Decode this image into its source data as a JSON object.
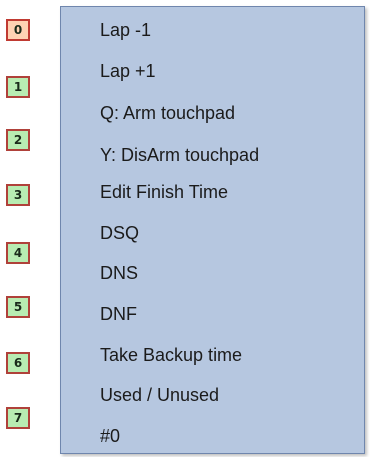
{
  "lane_buttons": [
    {
      "label": "0",
      "selected": true
    },
    {
      "label": "1",
      "selected": false
    },
    {
      "label": "2",
      "selected": false
    },
    {
      "label": "3",
      "selected": false
    },
    {
      "label": "4",
      "selected": false
    },
    {
      "label": "5",
      "selected": false
    },
    {
      "label": "6",
      "selected": false
    },
    {
      "label": "7",
      "selected": false
    }
  ],
  "context_menu": {
    "items": [
      "Lap -1",
      "Lap +1",
      "Q: Arm touchpad",
      "Y: DisArm touchpad",
      "Edit Finish Time",
      "DSQ",
      "DNS",
      "DNF",
      "Take Backup time",
      "Used / Unused",
      "#0"
    ]
  },
  "colors": {
    "button_fill": "#b8ecb2",
    "button_border": "#b0413a",
    "selected_fill": "#ffd2b3",
    "menu_background": "#b6c7e0",
    "menu_border": "#6f86ad"
  }
}
